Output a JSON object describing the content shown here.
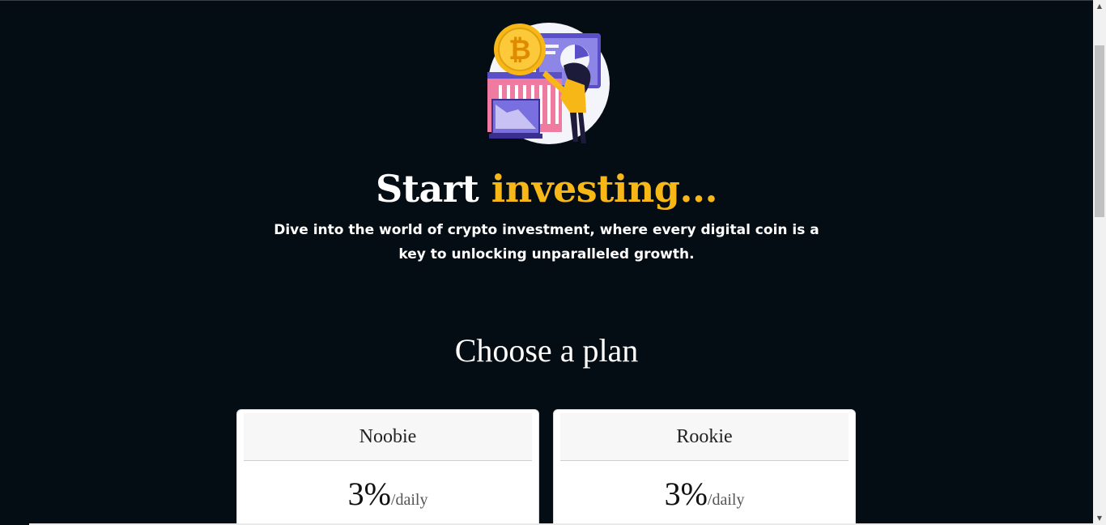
{
  "hero": {
    "title_main": "Start",
    "title_accent": "investing...",
    "subtitle": "Dive into the world of crypto investment, where every digital coin is a key to unlocking unparalleled growth."
  },
  "plans_section": {
    "title": "Choose a plan",
    "plans": [
      {
        "name": "Noobie",
        "rate": "3%",
        "period": "/daily"
      },
      {
        "name": "Rookie",
        "rate": "3%",
        "period": "/daily"
      }
    ]
  },
  "colors": {
    "background": "#050d14",
    "accent": "#f7b817",
    "text": "#ffffff",
    "card": "#ffffff"
  },
  "icons": {
    "hero": "crypto-investing-illustration",
    "scroll_up": "scroll-up-arrow-icon",
    "scroll_down": "scroll-down-arrow-icon"
  }
}
